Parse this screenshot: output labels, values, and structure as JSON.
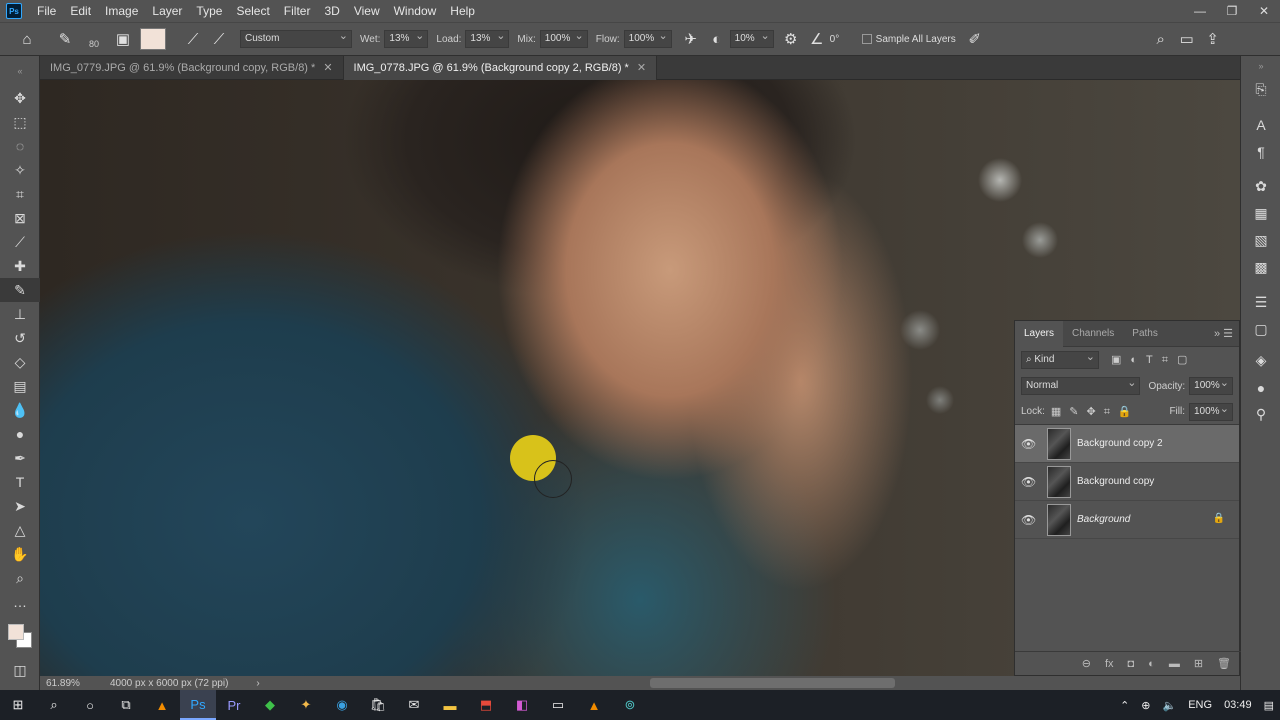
{
  "menu": {
    "items": [
      "File",
      "Edit",
      "Image",
      "Layer",
      "Type",
      "Select",
      "Filter",
      "3D",
      "View",
      "Window",
      "Help"
    ],
    "app_badge": "Ps"
  },
  "options": {
    "brush_size": "80",
    "preset": "Custom",
    "wet_label": "Wet:",
    "wet": "13%",
    "load_label": "Load:",
    "load": "13%",
    "mix_label": "Mix:",
    "mix": "100%",
    "flow_label": "Flow:",
    "flow": "100%",
    "smooth": "10%",
    "angle": "0°",
    "sample_label": "Sample All Layers",
    "swatch_color": "#f2e2d8"
  },
  "tabs": [
    {
      "label": "IMG_0779.JPG @ 61.9% (Background copy, RGB/8) *",
      "active": false
    },
    {
      "label": "IMG_0778.JPG @ 61.9% (Background copy 2, RGB/8) *",
      "active": true
    }
  ],
  "status": {
    "zoom": "61.89%",
    "doc": "4000 px x 6000 px (72 ppi)"
  },
  "layers_panel": {
    "tabs": [
      "Layers",
      "Channels",
      "Paths"
    ],
    "kind": "Kind",
    "blend": "Normal",
    "opacity_label": "Opacity:",
    "opacity": "100%",
    "lock_label": "Lock:",
    "fill_label": "Fill:",
    "fill": "100%",
    "layers": [
      {
        "name": "Background copy 2",
        "selected": true,
        "locked": false
      },
      {
        "name": "Background copy",
        "selected": false,
        "locked": false
      },
      {
        "name": "Background",
        "selected": false,
        "locked": true
      }
    ]
  },
  "taskbar": {
    "lang": "ENG",
    "time": "03:49"
  }
}
